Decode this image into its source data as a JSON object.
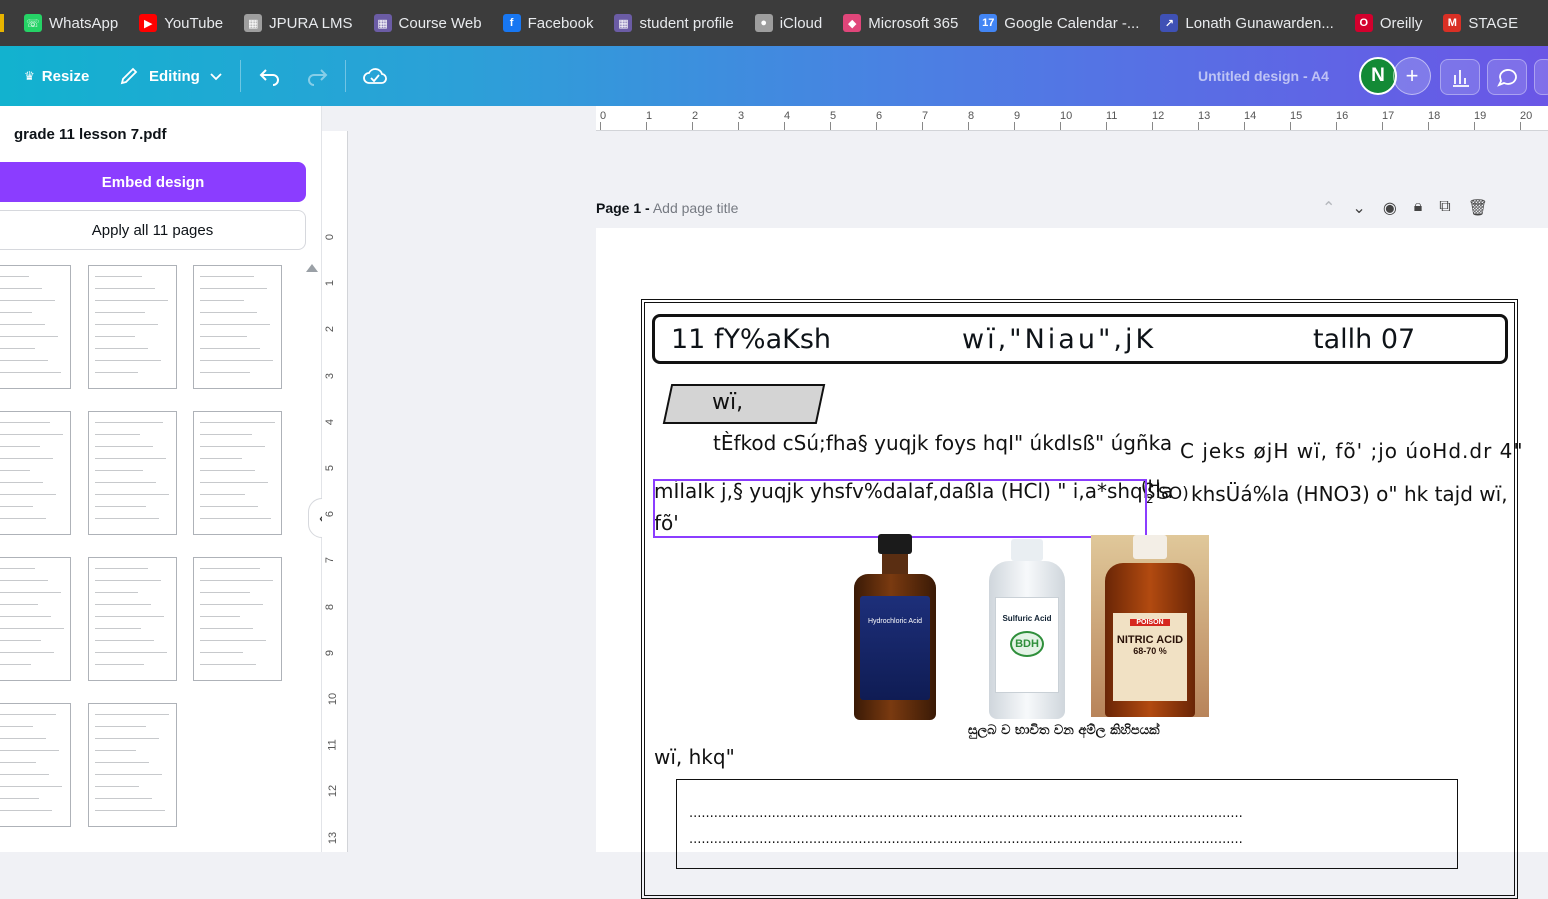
{
  "bookmarks": [
    {
      "label": "WhatsApp",
      "icon": "whatsapp-icon",
      "color": "#25d366"
    },
    {
      "label": "YouTube",
      "icon": "youtube-icon",
      "color": "#ff0000"
    },
    {
      "label": "JPURA LMS",
      "icon": "lms-icon",
      "color": "#9e9e9e"
    },
    {
      "label": "Course Web",
      "icon": "course-web-icon",
      "color": "#6b5ca5"
    },
    {
      "label": "Facebook",
      "icon": "facebook-icon",
      "color": "#1877f2"
    },
    {
      "label": "student profile",
      "icon": "student-profile-icon",
      "color": "#6b5ca5"
    },
    {
      "label": "iCloud",
      "icon": "apple-icon",
      "color": "#9e9e9e"
    },
    {
      "label": "Microsoft 365",
      "icon": "microsoft-365-icon",
      "color": "#e0467a"
    },
    {
      "label": "Google Calendar -...",
      "icon": "calendar-icon",
      "color": "#4285f4"
    },
    {
      "label": "Lonath Gunawarden...",
      "icon": "link-icon",
      "color": "#3f51b5"
    },
    {
      "label": "Oreilly",
      "icon": "oreilly-icon",
      "color": "#d3002d"
    },
    {
      "label": "STAGE",
      "icon": "gmail-icon",
      "color": "#d93025"
    }
  ],
  "toolbar": {
    "resize_label": "Resize",
    "editing_label": "Editing",
    "design_title": "Untitled design - A4",
    "avatar_initial": "N"
  },
  "sidebar": {
    "file_name": "grade 11 lesson 7.pdf",
    "embed_label": "Embed design",
    "apply_label": "Apply all 11 pages"
  },
  "ruler": {
    "top": [
      "0",
      "1",
      "2",
      "3",
      "4",
      "5",
      "6",
      "7",
      "8",
      "9",
      "10",
      "11",
      "12",
      "13",
      "14",
      "15",
      "16",
      "17",
      "18",
      "19",
      "20"
    ],
    "left": [
      "0",
      "1",
      "2",
      "3",
      "4",
      "5",
      "6",
      "7",
      "8",
      "9",
      "10",
      "11",
      "12",
      "13"
    ]
  },
  "page_header": {
    "page_label": "Page 1 -",
    "title_placeholder": "Add page title"
  },
  "document": {
    "header_left": "11 fY%aKsh",
    "header_center": "wï,\"Niau\",jK",
    "header_right": "tallh 07",
    "section_label": "wï,",
    "line1": "tÈfkod cSú;fha§ yuqjk foys hqI\" úkdlsß\" úgñka",
    "line1_cont": "C jeks øjH wï, fõ' ;jo úoHd.dr 4\"",
    "line2_sel": "mÍlaIk j,§ yuqjk yhsfv%dalaf,daßla (HCl) \" i,a*shqßla",
    "line2_tail": "khsÜá%la (HNO3) o\" hk tajd wï,",
    "line2_overlap": "(H",
    "subscript_2": "2",
    "overlap_so": "SO)",
    "line3": "fõ'",
    "caption": "සුලබ ව භාවිත වන අම්ල කිහිපයක්",
    "label_bottles": [
      "Hydrochloric Acid",
      "Sulfuric Acid",
      "NITRIC ACID"
    ],
    "nitric_sub": "68-70 %",
    "poison": "POISON",
    "bdh": "BDH",
    "properties_label": "wï, hkq\"",
    "answer_dots": "......................................................................................................................................"
  }
}
